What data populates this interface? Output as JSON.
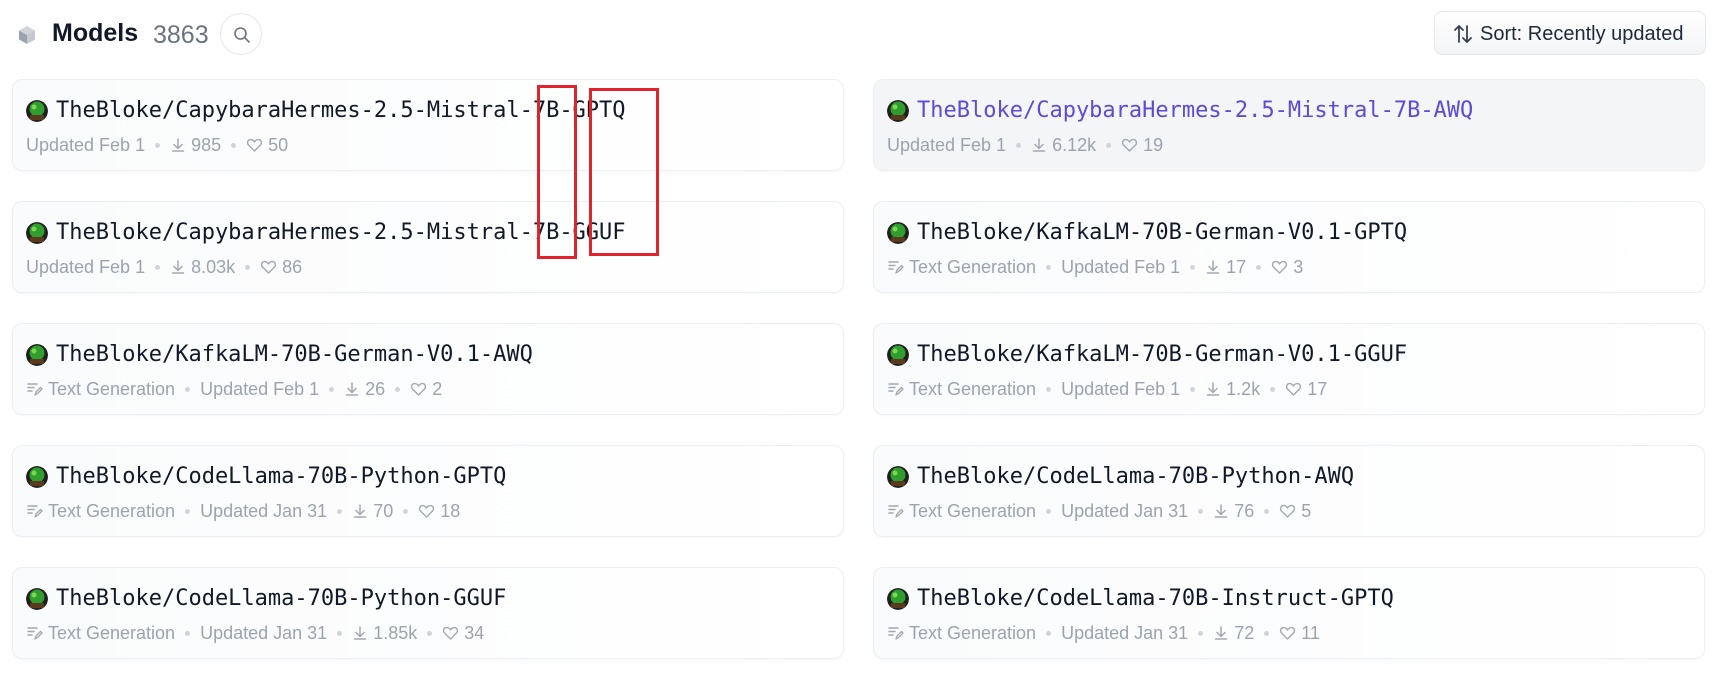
{
  "header": {
    "title": "Models",
    "count": "3863",
    "sort_label": "Sort:  Recently updated"
  },
  "models": [
    {
      "name": "TheBloke/CapybaraHermes-2.5-Mistral-7B-GPTQ",
      "pipeline": "",
      "updated": "Updated Feb 1",
      "downloads": "985",
      "likes": "50"
    },
    {
      "name": "TheBloke/CapybaraHermes-2.5-Mistral-7B-AWQ",
      "pipeline": "",
      "updated": "Updated Feb 1",
      "downloads": "6.12k",
      "likes": "19"
    },
    {
      "name": "TheBloke/CapybaraHermes-2.5-Mistral-7B-GGUF",
      "pipeline": "",
      "updated": "Updated Feb 1",
      "downloads": "8.03k",
      "likes": "86"
    },
    {
      "name": "TheBloke/KafkaLM-70B-German-V0.1-GPTQ",
      "pipeline": "Text Generation",
      "updated": "Updated Feb 1",
      "downloads": "17",
      "likes": "3"
    },
    {
      "name": "TheBloke/KafkaLM-70B-German-V0.1-AWQ",
      "pipeline": "Text Generation",
      "updated": "Updated Feb 1",
      "downloads": "26",
      "likes": "2"
    },
    {
      "name": "TheBloke/KafkaLM-70B-German-V0.1-GGUF",
      "pipeline": "Text Generation",
      "updated": "Updated Feb 1",
      "downloads": "1.2k",
      "likes": "17"
    },
    {
      "name": "TheBloke/CodeLlama-70B-Python-GPTQ",
      "pipeline": "Text Generation",
      "updated": "Updated Jan 31",
      "downloads": "70",
      "likes": "18"
    },
    {
      "name": "TheBloke/CodeLlama-70B-Python-AWQ",
      "pipeline": "Text Generation",
      "updated": "Updated Jan 31",
      "downloads": "76",
      "likes": "5"
    },
    {
      "name": "TheBloke/CodeLlama-70B-Python-GGUF",
      "pipeline": "Text Generation",
      "updated": "Updated Jan 31",
      "downloads": "1.85k",
      "likes": "34"
    },
    {
      "name": "TheBloke/CodeLlama-70B-Instruct-GPTQ",
      "pipeline": "Text Generation",
      "updated": "Updated Jan 31",
      "downloads": "72",
      "likes": "11"
    }
  ],
  "colors": {
    "hover_link": "#5b4bd8",
    "annotation_red": "#e0242c"
  },
  "icons": {
    "models": "cube-icon",
    "search": "search-icon",
    "sort": "sort-arrows-icon",
    "pipeline": "text-generation-icon",
    "downloads": "download-icon",
    "likes": "heart-icon"
  }
}
